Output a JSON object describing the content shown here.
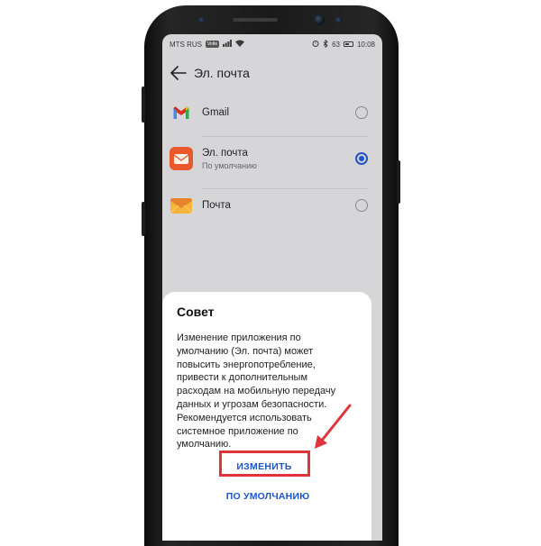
{
  "status_bar": {
    "carrier": "MTS RUS",
    "network_badge": "Volte",
    "battery_percent": "63",
    "battery_level": 0.63,
    "time": "10:08"
  },
  "app_bar": {
    "title": "Эл. почта",
    "back_icon": "arrow-left-icon"
  },
  "apps": [
    {
      "title": "Gmail",
      "subtitle": "",
      "icon": "gmail-icon",
      "selected": false
    },
    {
      "title": "Эл. почта",
      "subtitle": "По умолчанию",
      "icon": "huawei-email-icon",
      "selected": true
    },
    {
      "title": "Почта",
      "subtitle": "",
      "icon": "mail-envelope-icon",
      "selected": false
    }
  ],
  "dialog": {
    "title": "Совет",
    "lines": [
      "Изменение приложения по",
      "умолчанию (Эл. почта) может",
      "повысить энергопотребление,",
      "привести к дополнительным",
      "расходам на мобильную передачу",
      "данных и угрозам безопасности.",
      "Рекомендуется использовать",
      "системное приложение по",
      "умолчанию."
    ],
    "change_button": "ИЗМЕНИТЬ",
    "default_button": "ПО УМОЛЧАНИЮ"
  },
  "colors": {
    "accent": "#1d55c9",
    "annotation": "#e0343b",
    "screen_background": "#d6d6d8",
    "dialog_background": "#ffffff"
  }
}
